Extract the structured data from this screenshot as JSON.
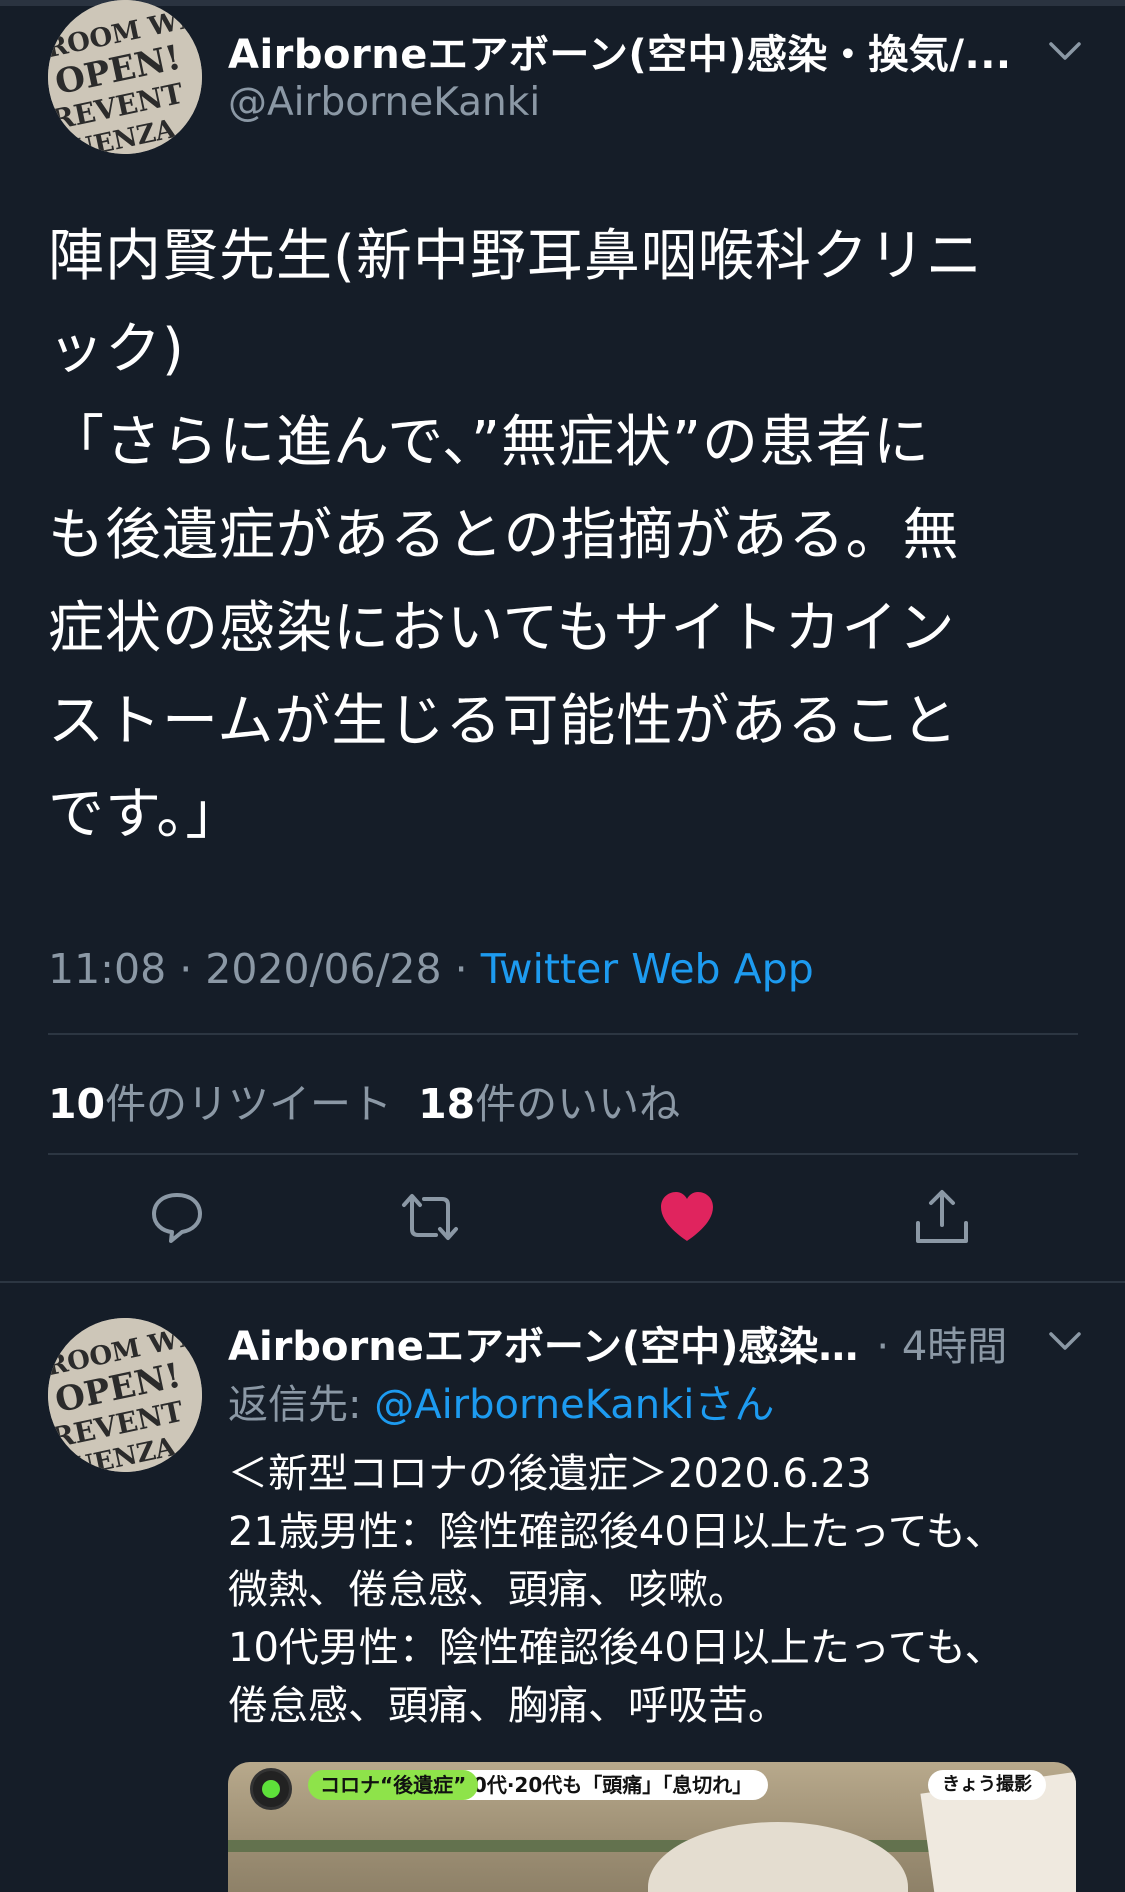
{
  "main_tweet": {
    "display_name": "Airborneエアボーン(空中)感染・換気/...",
    "handle": "@AirborneKanki",
    "avatar_icon": "avatar-open-window-sign",
    "text": "陣内賢先生(新中野耳鼻咽喉科クリニ\nック)\n「さらに進んで、”無症状”の患者に\nも後遺症があるとの指摘がある。無\n症状の感染においてもサイトカイン\nストームが生じる可能性があること\nです。」",
    "time": "11:08",
    "date": "2020/06/28",
    "separator": "·",
    "source": "Twitter Web App",
    "retweet_count": "10",
    "retweet_label": "件のリツイート",
    "like_count": "18",
    "like_label": "件のいいね",
    "actions": {
      "reply_icon": "reply-icon",
      "retweet_icon": "retweet-icon",
      "like_icon": "heart-filled-icon",
      "share_icon": "share-icon"
    },
    "liked": true
  },
  "reply_tweet": {
    "display_name": "Airborneエアボーン(空中)感染…",
    "time_ago": "· 4時間",
    "reply_prefix": "返信先: ",
    "reply_to": "@AirborneKankiさん",
    "text": "＜新型コロナの後遺症＞2020.6.23\n21歳男性：陰性確認後40日以上たっても、\n微熱、倦怠感、頭痛、咳嗽。\n10代男性：陰性確認後40日以上たっても、\n倦怠感、頭痛、胸痛、呼吸苦。",
    "media": {
      "tag_main": "コロナ“後遺症”",
      "tag_sub": "10代·20代も「頭痛」「息切れ」",
      "tag_today": "きょう撮影"
    }
  },
  "colors": {
    "background": "#151d28",
    "text_secondary": "#8b98a5",
    "link": "#1d9bf0",
    "like": "#e0245e",
    "divider": "#2c3642"
  }
}
